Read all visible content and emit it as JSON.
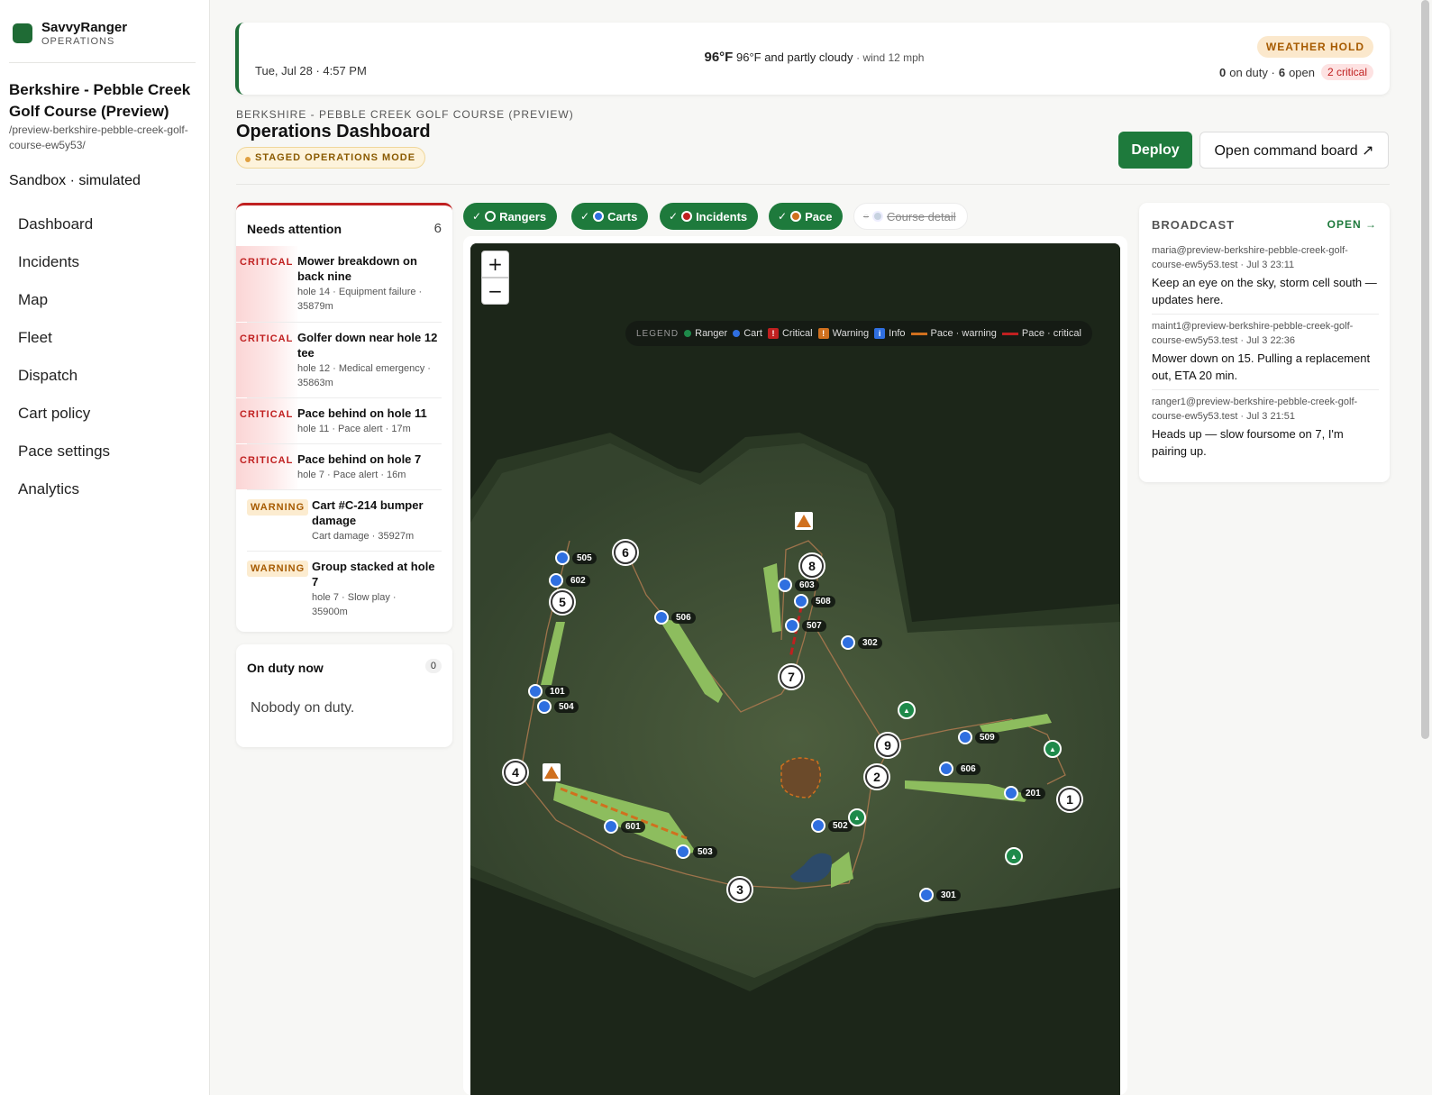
{
  "brand": {
    "name": "SavvyRanger",
    "sub": "OPERATIONS"
  },
  "sidebar": {
    "course_name": "Berkshire - Pebble Creek Golf Course (Preview)",
    "course_path": "/preview-berkshire-pebble-creek-golf-course-ew5y53/",
    "sandbox": "Sandbox · simulated",
    "nav": [
      "Dashboard",
      "Incidents",
      "Map",
      "Fleet",
      "Dispatch",
      "Cart policy",
      "Pace settings",
      "Analytics"
    ]
  },
  "weather": {
    "date": "Tue, Jul 28 · 4:57 PM",
    "temp": "96°F",
    "desc": "96°F and partly cloudy",
    "wind": "· wind 12 mph",
    "badge": "WEATHER HOLD",
    "on_duty": "0",
    "on_duty_label": "on duty ·",
    "open": "6",
    "open_label": "open",
    "critical": "2 critical"
  },
  "header": {
    "crumb": "BERKSHIRE - PEBBLE CREEK GOLF COURSE (PREVIEW)",
    "title": "Operations Dashboard",
    "mode": "STAGED OPERATIONS MODE",
    "deploy": "Deploy",
    "command_board": "Open command board ↗"
  },
  "attention": {
    "title": "Needs attention",
    "count": "6",
    "items": [
      {
        "tag": "CRITICAL",
        "title": "Mower breakdown on back nine",
        "sub": "hole 14 · Equipment failure · 35879m"
      },
      {
        "tag": "CRITICAL",
        "title": "Golfer down near hole 12 tee",
        "sub": "hole 12 · Medical emergency · 35863m"
      },
      {
        "tag": "CRITICAL",
        "title": "Pace behind on hole 11",
        "sub": "hole 11 · Pace alert · 17m"
      },
      {
        "tag": "CRITICAL",
        "title": "Pace behind on hole 7",
        "sub": "hole 7 · Pace alert · 16m"
      },
      {
        "tag": "WARNING",
        "title": "Cart #C-214 bumper damage",
        "sub": "Cart damage · 35927m"
      },
      {
        "tag": "WARNING",
        "title": "Group stacked at hole 7",
        "sub": "hole 7 · Slow play · 35900m"
      }
    ]
  },
  "duty": {
    "title": "On duty now",
    "count": "0",
    "empty": "Nobody on duty."
  },
  "layers": [
    {
      "label": "Rangers",
      "on": true,
      "color": "#1e7a3c"
    },
    {
      "label": "Carts",
      "on": true,
      "color": "#2f6fe0"
    },
    {
      "label": "Incidents",
      "on": true,
      "color": "#c02020"
    },
    {
      "label": "Pace",
      "on": true,
      "color": "#d0701e"
    },
    {
      "label": "Course detail",
      "on": false,
      "color": "#c7d2e0"
    }
  ],
  "map": {
    "zoom_in": "+",
    "zoom_out": "−",
    "legend": {
      "heading": "LEGEND",
      "ranger": "Ranger",
      "cart": "Cart",
      "critical": "Critical",
      "warning": "Warning",
      "info": "Info",
      "pace_warning": "Pace · warning",
      "pace_critical": "Pace · critical"
    },
    "holes": [
      "1",
      "2",
      "3",
      "4",
      "5",
      "6",
      "7",
      "8",
      "9"
    ],
    "carts": [
      "505",
      "602",
      "506",
      "603",
      "508",
      "507",
      "302",
      "101",
      "504",
      "509",
      "606",
      "201",
      "601",
      "503",
      "502",
      "301"
    ],
    "colors": {
      "ranger": "#1e8a4a",
      "cart": "#2f6fe0",
      "critical": "#c02020",
      "warning": "#d0701e",
      "info": "#2f6fe0"
    }
  },
  "broadcast": {
    "title": "BROADCAST",
    "open": "OPEN →",
    "messages": [
      {
        "meta": "maria@preview-berkshire-pebble-creek-golf-course-ew5y53.test · Jul 3 23:11",
        "text": "Keep an eye on the sky, storm cell south — updates here."
      },
      {
        "meta": "maint1@preview-berkshire-pebble-creek-golf-course-ew5y53.test · Jul 3 22:36",
        "text": "Mower down on 15. Pulling a replacement out, ETA 20 min."
      },
      {
        "meta": "ranger1@preview-berkshire-pebble-creek-golf-course-ew5y53.test · Jul 3 21:51",
        "text": "Heads up — slow foursome on 7, I'm pairing up."
      }
    ]
  }
}
